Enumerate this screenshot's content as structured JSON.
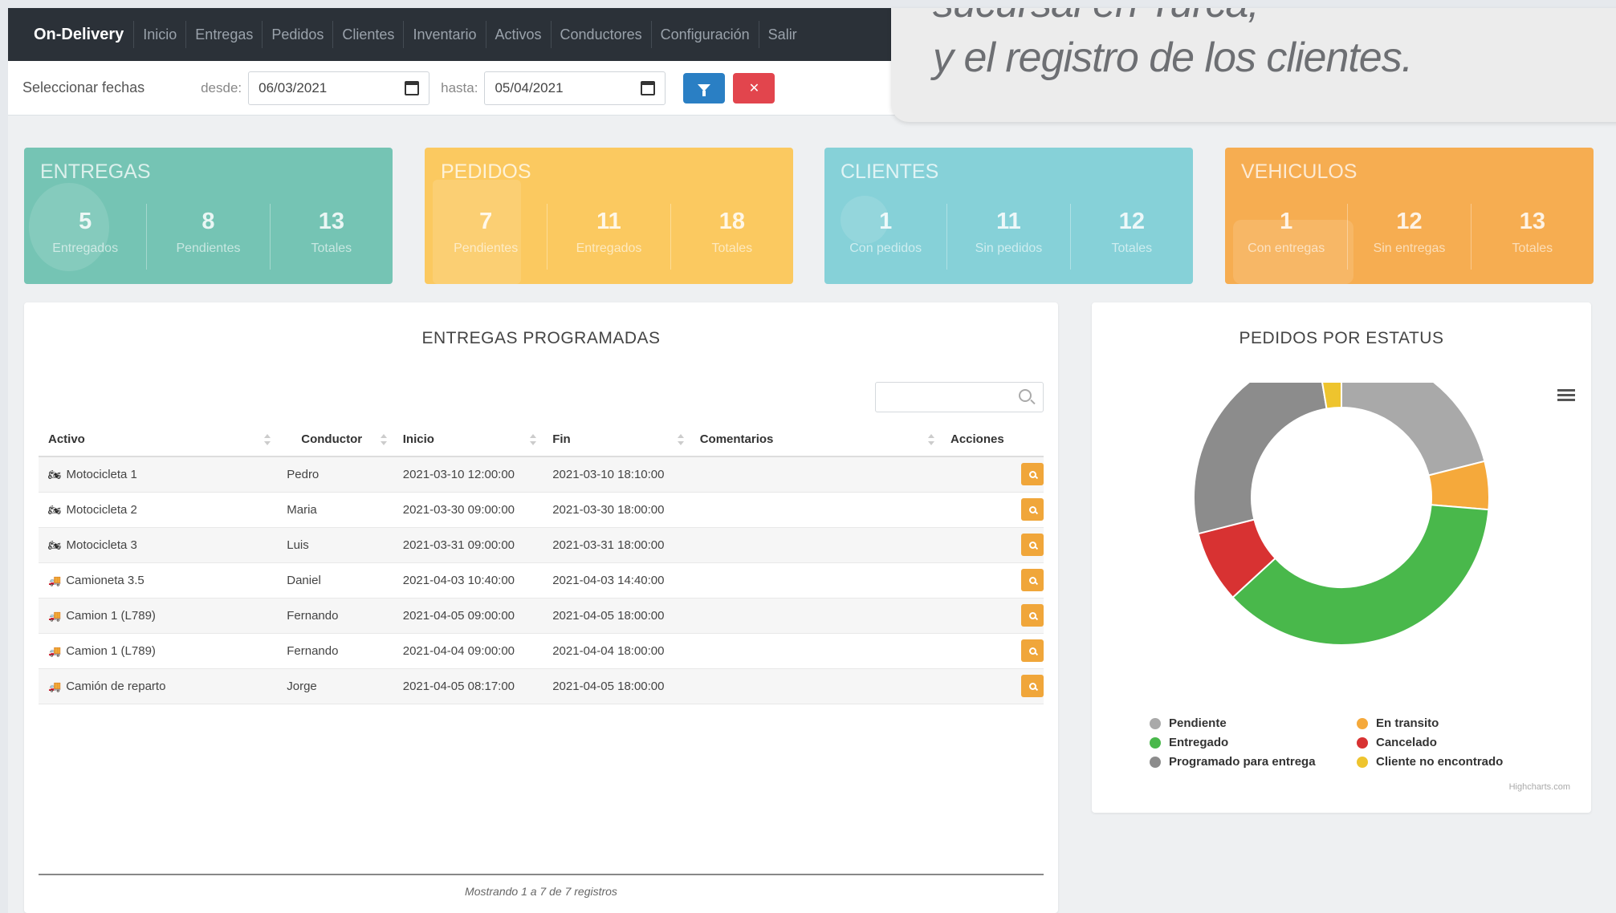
{
  "overlay": {
    "line1": "sucursal en Turca,",
    "line2": "y el registro de los clientes."
  },
  "nav": {
    "brand": "On-Delivery",
    "items": [
      "Inicio",
      "Entregas",
      "Pedidos",
      "Clientes",
      "Inventario",
      "Activos",
      "Conductores",
      "Configuración",
      "Salir"
    ]
  },
  "filters": {
    "title": "Seleccionar fechas",
    "from_label": "desde:",
    "from_value": "06/03/2021",
    "to_label": "hasta:",
    "to_value": "05/04/2021",
    "clear_icon": "✕"
  },
  "kpis": {
    "entregas": {
      "title": "ENTREGAS",
      "stats": [
        {
          "value": "5",
          "label": "Entregados"
        },
        {
          "value": "8",
          "label": "Pendientes"
        },
        {
          "value": "13",
          "label": "Totales"
        }
      ]
    },
    "pedidos": {
      "title": "PEDIDOS",
      "stats": [
        {
          "value": "7",
          "label": "Pendientes"
        },
        {
          "value": "11",
          "label": "Entregados"
        },
        {
          "value": "18",
          "label": "Totales"
        }
      ]
    },
    "clientes": {
      "title": "CLIENTES",
      "stats": [
        {
          "value": "1",
          "label": "Con pedidos"
        },
        {
          "value": "11",
          "label": "Sin pedidos"
        },
        {
          "value": "12",
          "label": "Totales"
        }
      ]
    },
    "vehiculos": {
      "title": "VEHICULOS",
      "stats": [
        {
          "value": "1",
          "label": "Con entregas"
        },
        {
          "value": "12",
          "label": "Sin entregas"
        },
        {
          "value": "13",
          "label": "Totales"
        }
      ]
    }
  },
  "table": {
    "title": "ENTREGAS PROGRAMADAS",
    "search_placeholder": "",
    "columns": [
      "Activo",
      "Conductor",
      "Inicio",
      "Fin",
      "Comentarios",
      "Acciones"
    ],
    "rows": [
      {
        "icon": "motorcycle-icon",
        "activo": "Motocicleta 1",
        "conductor": "Pedro",
        "inicio": "2021-03-10 12:00:00",
        "fin": "2021-03-10 18:10:00",
        "comentarios": ""
      },
      {
        "icon": "motorcycle-icon",
        "activo": "Motocicleta 2",
        "conductor": "Maria",
        "inicio": "2021-03-30 09:00:00",
        "fin": "2021-03-30 18:00:00",
        "comentarios": ""
      },
      {
        "icon": "motorcycle-icon",
        "activo": "Motocicleta 3",
        "conductor": "Luis",
        "inicio": "2021-03-31 09:00:00",
        "fin": "2021-03-31 18:00:00",
        "comentarios": ""
      },
      {
        "icon": "truck-icon",
        "activo": "Camioneta 3.5",
        "conductor": "Daniel",
        "inicio": "2021-04-03 10:40:00",
        "fin": "2021-04-03 14:40:00",
        "comentarios": ""
      },
      {
        "icon": "truck-icon",
        "activo": "Camion 1 (L789)",
        "conductor": "Fernando",
        "inicio": "2021-04-05 09:00:00",
        "fin": "2021-04-05 18:00:00",
        "comentarios": ""
      },
      {
        "icon": "truck-icon",
        "activo": "Camion 1 (L789)",
        "conductor": "Fernando",
        "inicio": "2021-04-04 09:00:00",
        "fin": "2021-04-04 18:00:00",
        "comentarios": ""
      },
      {
        "icon": "truck-icon",
        "activo": "Camión de reparto",
        "conductor": "Jorge",
        "inicio": "2021-04-05 08:17:00",
        "fin": "2021-04-05 18:00:00",
        "comentarios": ""
      }
    ],
    "footer": "Mostrando 1 a 7 de 7 registros"
  },
  "chart_panel": {
    "title": "PEDIDOS POR ESTATUS",
    "credit": "Highcharts.com"
  },
  "chart_data": {
    "type": "pie",
    "variant": "donut",
    "title": "PEDIDOS POR ESTATUS",
    "slices": [
      {
        "name": "Pendiente",
        "value": 4,
        "color": "#a9a9a9"
      },
      {
        "name": "En transito",
        "value": 1,
        "color": "#f5a93b"
      },
      {
        "name": "Entregado",
        "value": 7,
        "color": "#49b84b"
      },
      {
        "name": "Cancelado",
        "value": 1.5,
        "color": "#d83232"
      },
      {
        "name": "Programado para entrega",
        "value": 5,
        "color": "#8c8c8c"
      },
      {
        "name": "Cliente no encontrado",
        "value": 0.5,
        "color": "#eec42e"
      }
    ],
    "legend_position": "bottom"
  }
}
